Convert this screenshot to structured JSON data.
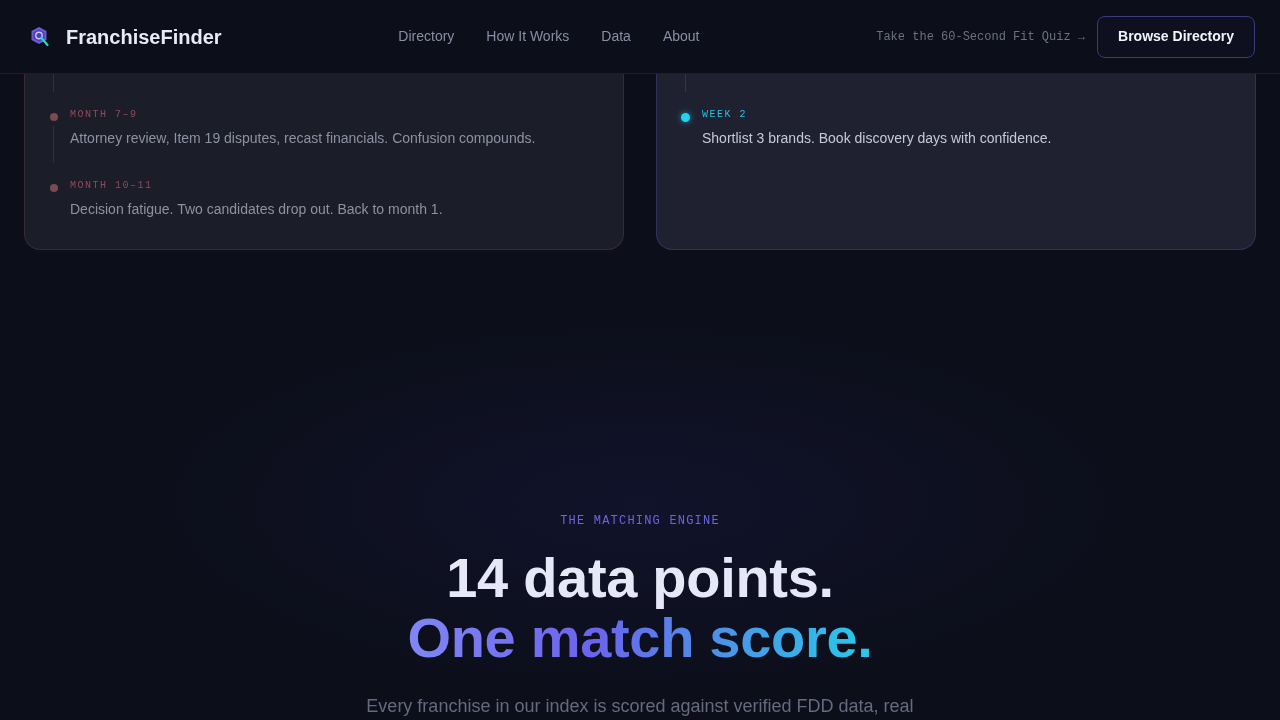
{
  "navbar": {
    "brand": "FranchiseFinder",
    "links": [
      {
        "label": "Directory"
      },
      {
        "label": "How It Works"
      },
      {
        "label": "Data"
      },
      {
        "label": "About"
      }
    ],
    "quiz_link": "Take the 60-Second Fit Quiz →",
    "button": "Browse Directory"
  },
  "timelines": [
    {
      "kind": "before",
      "items": [
        {
          "label": "MONTH 7–9",
          "text": "Attorney review, Item 19 disputes, recast financials. Confusion compounds."
        },
        {
          "label": "MONTH 10–11",
          "text": "Decision fatigue. Two candidates drop out. Back to month 1."
        }
      ]
    },
    {
      "kind": "after",
      "items": [
        {
          "label": "WEEK 2",
          "text": "Shortlist 3 brands. Book discovery days with confidence."
        }
      ]
    }
  ],
  "matching_engine": {
    "eyebrow": "THE MATCHING ENGINE",
    "title": "14 data points.",
    "title_highlight": "One match score.",
    "description": "Every franchise in our index is scored against verified FDD data, real"
  }
}
